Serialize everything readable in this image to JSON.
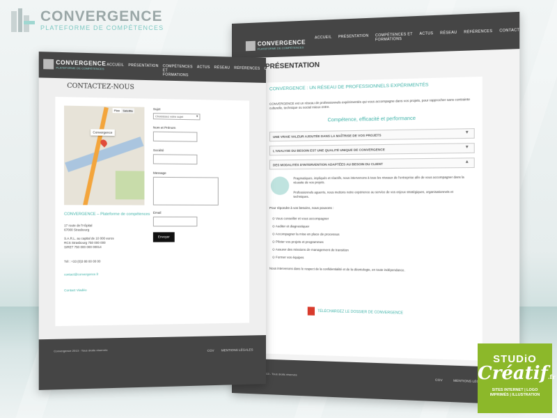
{
  "brand": {
    "title": "CONVERGENCE",
    "subtitle": "PLATEFORME DE COMPÉTENCES"
  },
  "nav": [
    "ACCUEIL",
    "PRÉSENTATION",
    "COMPÉTENCES ET FORMATIONS",
    "ACTUS",
    "RÉSEAU",
    "RÉFÉRENCES",
    "CONTACT"
  ],
  "contact_page": {
    "logo_title": "CONVERGENCE",
    "logo_sub": "PLATEFORME DE COMPÉTENCES",
    "title": "CONTACTEZ-NOUS",
    "map_pin_label": "Convergence",
    "map_tab_map": "Plan",
    "map_tab_sat": "Satellite",
    "company_name": "CONVERGENCE – Plateforme de compétences",
    "address_1": "17 route de l'Hôpital",
    "address_2": "67000 Strasbourg",
    "legal_1": "S.A.R.L. au capital de 10 000 euros",
    "legal_2": "RCS Strasbourg 750 000 000",
    "legal_3": "SIRET 750 000 000 00014",
    "tel": "Tél : +33 (0)3 88 00 00 00",
    "email": "contact@convergence.fr",
    "email_link": "Contact Viadéo",
    "form": {
      "subject_label": "Sujet",
      "subject_value": "Choisissez votre sujet",
      "name_label": "Nom et Prénom",
      "company_label": "Société",
      "message_label": "Message",
      "email_label": "Email",
      "submit": "Envoyer"
    },
    "footer_left": "Convergence 2013 - Tous droits réservés",
    "footer_cgv": "CGV",
    "footer_legal": "MENTIONS LÉGALES"
  },
  "presentation_page": {
    "logo_title": "CONVERGENCE",
    "logo_sub": "PLATEFORME DE COMPÉTENCES",
    "title": "PRÉSENTATION",
    "subtitle": "CONVERGENCE : UN RÉSEAU DE PROFESSIONNELS EXPÉRIMENTÉS",
    "intro": "CONVERGENCE est un réseau de professionnels expérimentés qui vous accompagne dans vos projets, pour rapprocher sans contrainte culturelle, technique ou social mieux entre.",
    "tagline": "Compétence, efficacité et performance",
    "accordions": [
      "UNE VRAIE VALEUR AJOUTÉE DANS LA MAÎTRISE DE VOS PROJETS",
      "L'ANALYSE DU BESOIN EST UNE QUALITÉ UNIQUE DE CONVERGENCE",
      "DES MODALITÉS D'INTERVENTION ADAPTÉES AU BESOIN DU CLIENT"
    ],
    "body_1": "Pragmatiques, impliqués et réactifs, nous intervenons à tous les niveaux de l'entreprise afin de vous accompagner dans la réussite de vos projets.",
    "body_2": "Professionnels aguerris, nous mettons notre expérience au service de vos enjeux stratégiques, organisationnels et techniques.",
    "lead": "Pour répondre à vos besoins, nous pouvons :",
    "bullets": [
      "Vous conseiller et vous accompagner",
      "Auditer et diagnostiquer",
      "Accompagner la mise en place de processus",
      "Piloter vos projets et programmes",
      "Assurer des missions de management de transition",
      "Former vos équipes"
    ],
    "closing": "Nous intervenons dans le respect de la confidentialité et de la déontologie, en toute indépendance.",
    "download": "TÉLÉCHARGEZ LE DOSSIER DE CONVERGENCE",
    "footer_left": "Convergence 2013 - Tous droits réservés",
    "footer_cgv": "CGV",
    "footer_legal": "MENTIONS LÉGALES"
  },
  "badge": {
    "line1": "STUDiO",
    "line2": "Créatif",
    "fr": ".fr",
    "line3": "SITES INTERNET | LOGO",
    "line4": "IMPRIMÉS | ILLUSTRATION"
  },
  "colors": {
    "accent": "#3fb3a9",
    "header": "#454545",
    "badge": "#8cb82a"
  }
}
